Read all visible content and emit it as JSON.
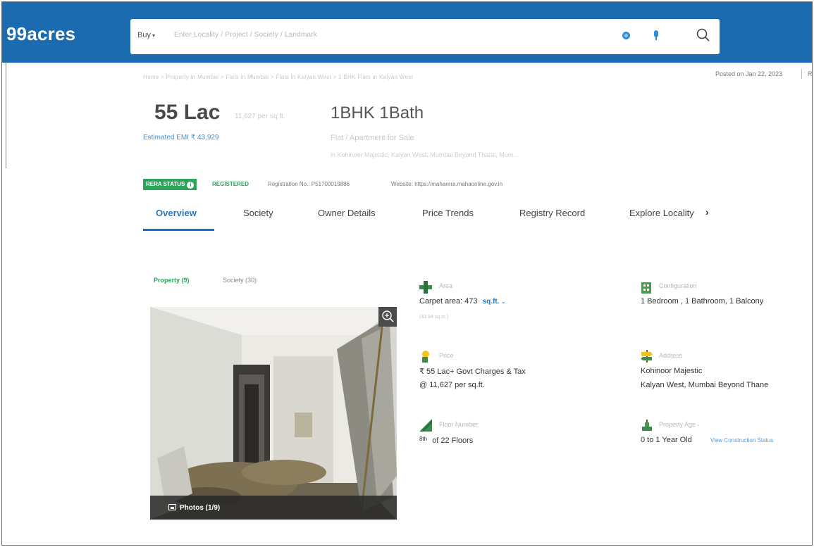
{
  "header": {
    "logo": "99acres",
    "search": {
      "buy_label": "Buy",
      "placeholder": "Enter Locality / Project / Society / Landmark"
    }
  },
  "breadcrumb": "Home > Property in Mumbai > Flats in Mumbai > Flats in Kalyan West > 1 BHK Flats in Kalyan West",
  "posted": "Posted on Jan 22, 2023",
  "posted_extra": "R",
  "listing": {
    "price": "55 Lac",
    "price_per": "11,627 per sq.ft.",
    "emi": "Estimated EMI ₹ 43,929",
    "bhk": "1BHK 1Bath",
    "type": "Flat / Apartment for Sale",
    "location": "in Kohinoor Majestic, Kalyan West, Mumbai Beyond Thane, Mum..."
  },
  "rera": {
    "badge": "RERA STATUS",
    "info": "i",
    "status": "REGISTERED",
    "reg_no": "Registration No.: P51700019886",
    "website": "Website: https://maharera.mahaonline.gov.in"
  },
  "tabs": [
    {
      "label": "Overview"
    },
    {
      "label": "Society"
    },
    {
      "label": "Owner Details"
    },
    {
      "label": "Price Trends"
    },
    {
      "label": "Registry Record"
    },
    {
      "label": "Explore Locality"
    }
  ],
  "tab_chevron": "›",
  "gallery": {
    "tab_property": "Property (9)",
    "tab_society": "Society (30)",
    "photos_label": "Photos (1/9)"
  },
  "details": {
    "area": {
      "label": "Area",
      "value": "Carpet area: 473",
      "unit": "sq.ft.",
      "sub": "(43.94 sq.m.)"
    },
    "configuration": {
      "label": "Configuration",
      "value": "1 Bedroom , 1 Bathroom, 1 Balcony"
    },
    "price": {
      "label": "Price",
      "value": "₹ 55 Lac+ Govt Charges & Tax",
      "value2": "@ 11,627 per sq.ft."
    },
    "address": {
      "label": "Address",
      "value": "Kohinoor Majestic",
      "value2": "Kalyan West, Mumbai Beyond Thane"
    },
    "floor": {
      "label": "Floor Number",
      "value_sup": "8th",
      "value": "of 22 Floors"
    },
    "age": {
      "label": "Property Age",
      "value": "0 to 1 Year Old",
      "link": "View Construction Status"
    }
  }
}
